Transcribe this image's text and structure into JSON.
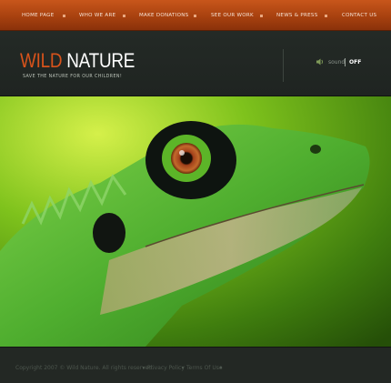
{
  "nav": {
    "items": [
      {
        "label": "HOME PAGE"
      },
      {
        "label": "WHO WE ARE"
      },
      {
        "label": "MAKE DONATIONS"
      },
      {
        "label": "SEE OUR WORK"
      },
      {
        "label": "NEWS & PRESS"
      },
      {
        "label": "CONTACT US"
      }
    ]
  },
  "header": {
    "logo_word1": "WILD",
    "logo_word2": "NATURE",
    "slogan": "SAVE THE NATURE FOR OUR CHILDREN!",
    "sound_label": "sound",
    "sound_state": "OFF"
  },
  "hero": {
    "icon": "lizard-photo"
  },
  "footer": {
    "copyright": "Copyright 2007 © Wild Nature. All rights reserved.",
    "privacy": "Privacy Policy",
    "terms": "Terms Of Use"
  },
  "colors": {
    "nav_orange": "#b84a14",
    "logo_orange": "#d8531b",
    "header_bg": "#222724",
    "footer_bg": "#232824"
  }
}
